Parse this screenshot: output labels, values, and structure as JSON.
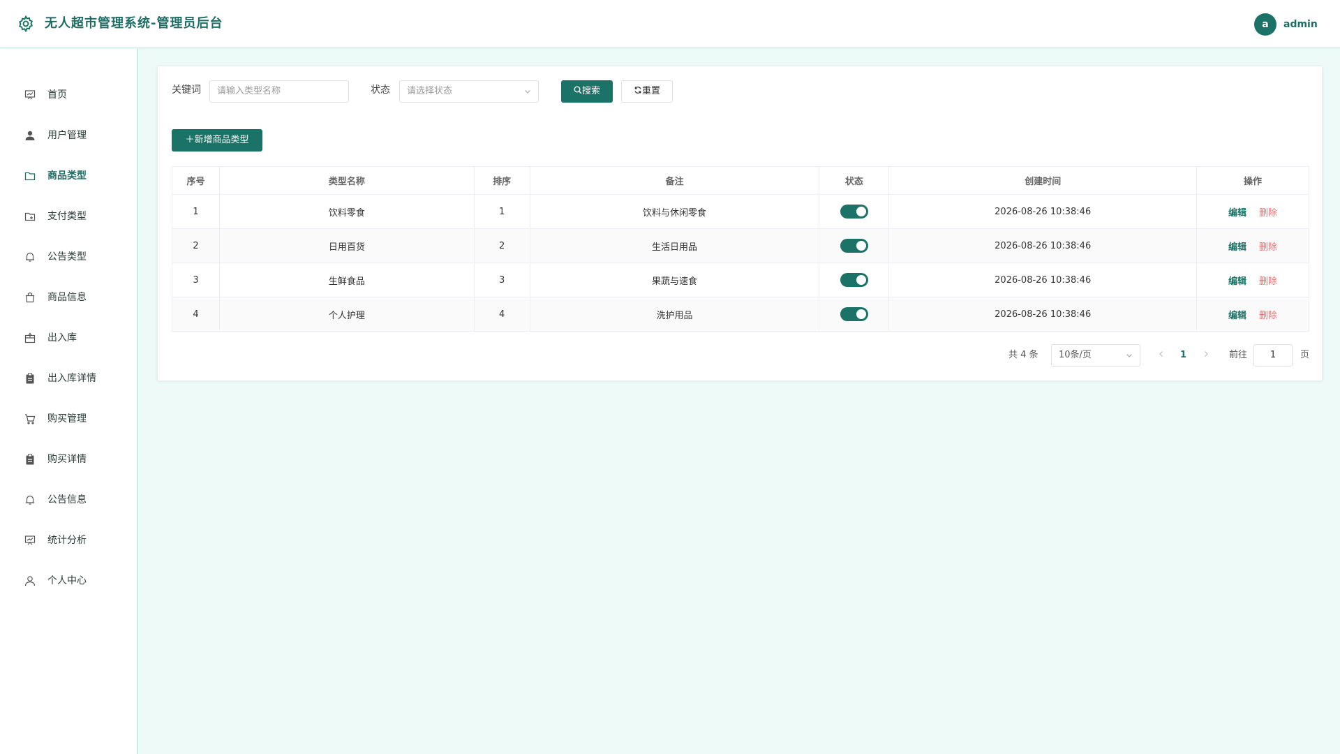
{
  "header": {
    "title": "无人超市管理系统-管理员后台",
    "avatar_letter": "a",
    "username": "admin"
  },
  "sidebar": {
    "items": [
      {
        "label": "首页",
        "icon": "presentation-icon"
      },
      {
        "label": "用户管理",
        "icon": "user-filled-icon"
      },
      {
        "label": "商品类型",
        "icon": "folder-icon"
      },
      {
        "label": "支付类型",
        "icon": "folder-add-icon"
      },
      {
        "label": "公告类型",
        "icon": "bell-icon"
      },
      {
        "label": "商品信息",
        "icon": "shopping-bag-icon"
      },
      {
        "label": "出入库",
        "icon": "box-icon"
      },
      {
        "label": "出入库详情",
        "icon": "clipboard-icon"
      },
      {
        "label": "购买管理",
        "icon": "cart-icon"
      },
      {
        "label": "购买详情",
        "icon": "clipboard-icon"
      },
      {
        "label": "公告信息",
        "icon": "bell-icon"
      },
      {
        "label": "统计分析",
        "icon": "presentation-icon"
      },
      {
        "label": "个人中心",
        "icon": "user-icon"
      }
    ],
    "active": "商品类型"
  },
  "search": {
    "keyword_label": "关键词",
    "keyword_placeholder": "请输入类型名称",
    "status_label": "状态",
    "status_placeholder": "请选择状态",
    "search_button": "搜索",
    "reset_button": "重置"
  },
  "toolbar": {
    "add_button": "新增商品类型"
  },
  "table": {
    "headers": {
      "index": "序号",
      "name": "类型名称",
      "sort": "排序",
      "remark": "备注",
      "status": "状态",
      "created": "创建时间",
      "actions": "操作"
    },
    "rows": [
      {
        "index": "1",
        "name": "饮料零食",
        "sort": "1",
        "remark": "饮料与休闲零食",
        "status": true,
        "created": "2026-08-26 10:38:46"
      },
      {
        "index": "2",
        "name": "日用百货",
        "sort": "2",
        "remark": "生活日用品",
        "status": true,
        "created": "2026-08-26 10:38:46"
      },
      {
        "index": "3",
        "name": "生鲜食品",
        "sort": "3",
        "remark": "果蔬与速食",
        "status": true,
        "created": "2026-08-26 10:38:46"
      },
      {
        "index": "4",
        "name": "个人护理",
        "sort": "4",
        "remark": "洗护用品",
        "status": true,
        "created": "2026-08-26 10:38:46"
      }
    ],
    "edit_label": "编辑",
    "delete_label": "删除"
  },
  "pagination": {
    "total_text": "共 4 条",
    "page_size": "10条/页",
    "current_page": "1",
    "goto_label": "前往",
    "goto_value": "1",
    "page_suffix": "页"
  },
  "colors": {
    "primary": "#1a7366",
    "danger": "#f56c6c",
    "background": "#eefaf7"
  }
}
